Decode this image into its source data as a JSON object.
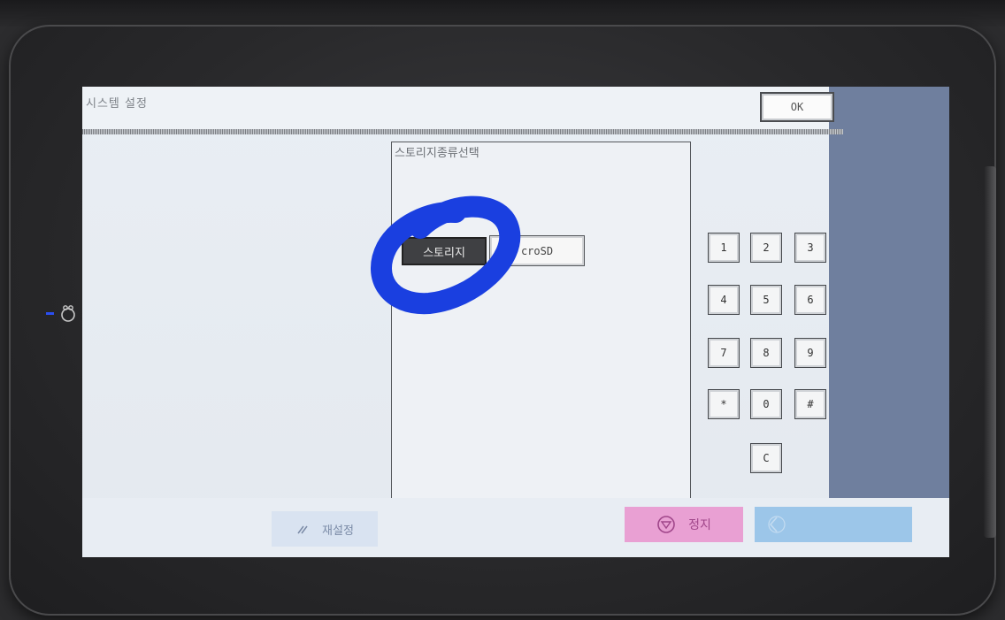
{
  "screen": {
    "title": "시스템 설정",
    "ok_label": "OK"
  },
  "panel": {
    "title": "스토리지종류선택",
    "options": [
      {
        "label": "스토리지",
        "selected": true
      },
      {
        "label": "croSD",
        "selected": false
      }
    ]
  },
  "keypad": {
    "keys": [
      "1",
      "2",
      "3",
      "4",
      "5",
      "6",
      "7",
      "8",
      "9",
      "*",
      "0",
      "#"
    ],
    "clear_label": "C"
  },
  "bottom": {
    "reset_label": "재설정",
    "stop_label": "정지"
  },
  "colors": {
    "annotation": "#1a3fe0",
    "stop": "#e9a0d3",
    "start": "#9cc6e9",
    "right_panel": "#6f7f9e"
  },
  "icons": {
    "reset": "slash-icon",
    "stop": "stop-icon",
    "start": "start-icon",
    "home": "home-icon"
  }
}
